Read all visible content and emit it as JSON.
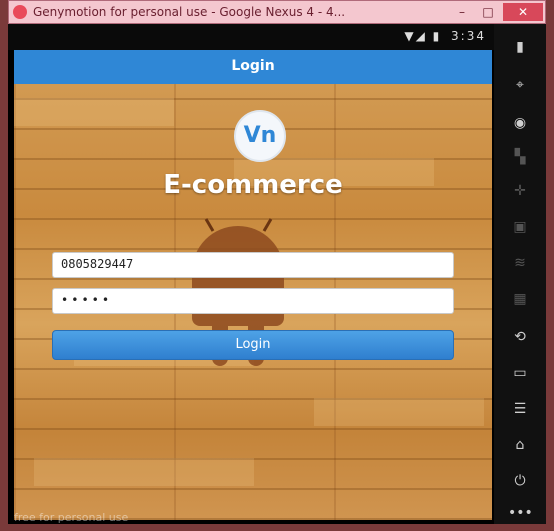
{
  "window": {
    "title": "Genymotion for personal use - Google Nexus 4 - 4...",
    "min_label": "–",
    "max_label": "□",
    "close_label": "✕"
  },
  "status_bar": {
    "icons": "▼◢ ▮",
    "time": "3:34"
  },
  "action_bar": {
    "title": "Login"
  },
  "app": {
    "logo_text": "Vn",
    "brand": "E-commerce"
  },
  "form": {
    "phone_value": "0805829447",
    "password_value": "•••••",
    "login_button": "Login"
  },
  "footer": {
    "watermark": "free for personal use"
  },
  "side_toolbar": {
    "items": [
      "battery-icon",
      "gps-icon",
      "camera-icon",
      "rotate-icon",
      "dpad-icon",
      "id-icon",
      "broadcast-icon",
      "menu-icon",
      "back-icon",
      "recent-icon",
      "home-icon",
      "power-icon",
      "more-icon"
    ]
  }
}
